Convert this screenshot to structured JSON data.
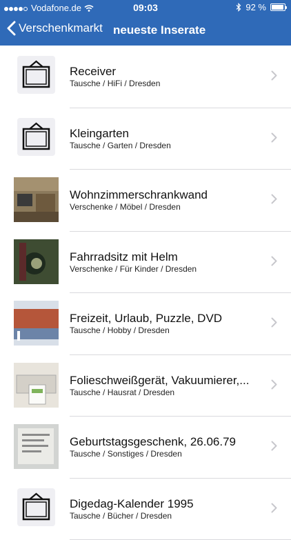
{
  "status": {
    "carrier": "Vodafone.de",
    "time": "09:03",
    "battery": "92 %",
    "battery_level": 0.92
  },
  "nav": {
    "back_label": "Verschenkmarkt",
    "title": "neueste Inserate"
  },
  "items": [
    {
      "title": "Receiver",
      "subtitle": "Tausche / HiFi / Dresden",
      "image": "placeholder"
    },
    {
      "title": "Kleingarten",
      "subtitle": "Tausche / Garten / Dresden",
      "image": "placeholder"
    },
    {
      "title": "Wohnzimmerschrankwand",
      "subtitle": "Verschenke / Möbel / Dresden",
      "image": "photo"
    },
    {
      "title": "Fahrradsitz mit Helm",
      "subtitle": "Verschenke / Für Kinder / Dresden",
      "image": "photo"
    },
    {
      "title": "Freizeit, Urlaub, Puzzle, DVD",
      "subtitle": "Tausche / Hobby / Dresden",
      "image": "photo"
    },
    {
      "title": "Folieschweißgerät, Vakuumierer,...",
      "subtitle": "Tausche / Hausrat / Dresden",
      "image": "photo"
    },
    {
      "title": "Geburtstagsgeschenk, 26.06.79",
      "subtitle": "Tausche / Sonstiges / Dresden",
      "image": "photo"
    },
    {
      "title": "Digedag-Kalender 1995",
      "subtitle": "Tausche / Bücher / Dresden",
      "image": "placeholder"
    }
  ],
  "colors": {
    "accent": "#2f6ab8",
    "separator": "#d9d9dd",
    "chevron": "#c7c7cc"
  }
}
